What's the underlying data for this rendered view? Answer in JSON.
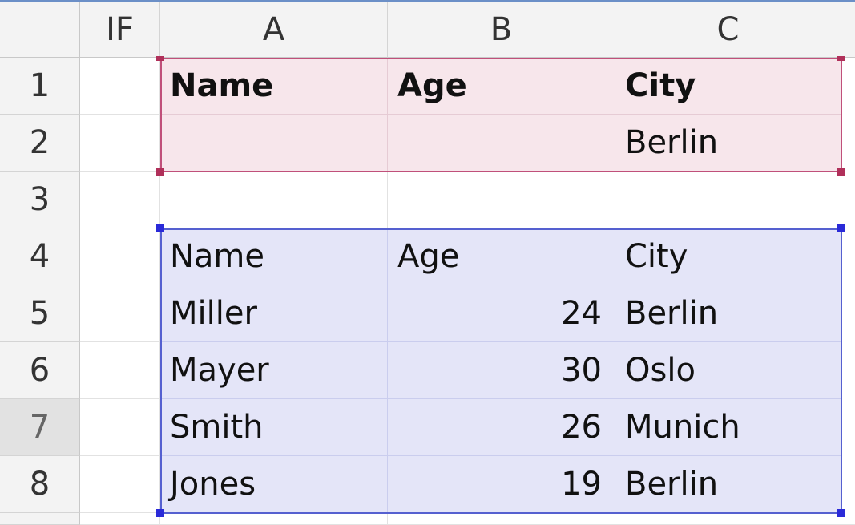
{
  "columns": [
    "IF",
    "A",
    "B",
    "C"
  ],
  "rows": [
    "1",
    "2",
    "3",
    "4",
    "5",
    "6",
    "7",
    "8"
  ],
  "active_row": "7",
  "colors": {
    "criteria_range_fill": "#f7e6eb",
    "criteria_range_border": "#c0507a",
    "data_range_fill": "#e4e5f8",
    "data_range_border": "#5560d0"
  },
  "cells": {
    "A1": "Name",
    "B1": "Age",
    "C1": "City",
    "A2": "",
    "B2": "",
    "C2": "Berlin",
    "A4": "Name",
    "B4": "Age",
    "C4": "City",
    "A5": "Miller",
    "B5": "24",
    "C5": "Berlin",
    "A6": "Mayer",
    "B6": "30",
    "C6": "Oslo",
    "A7": "Smith",
    "B7": "26",
    "C7": "Munich",
    "A8": "Jones",
    "B8": "19",
    "C8": "Berlin"
  }
}
